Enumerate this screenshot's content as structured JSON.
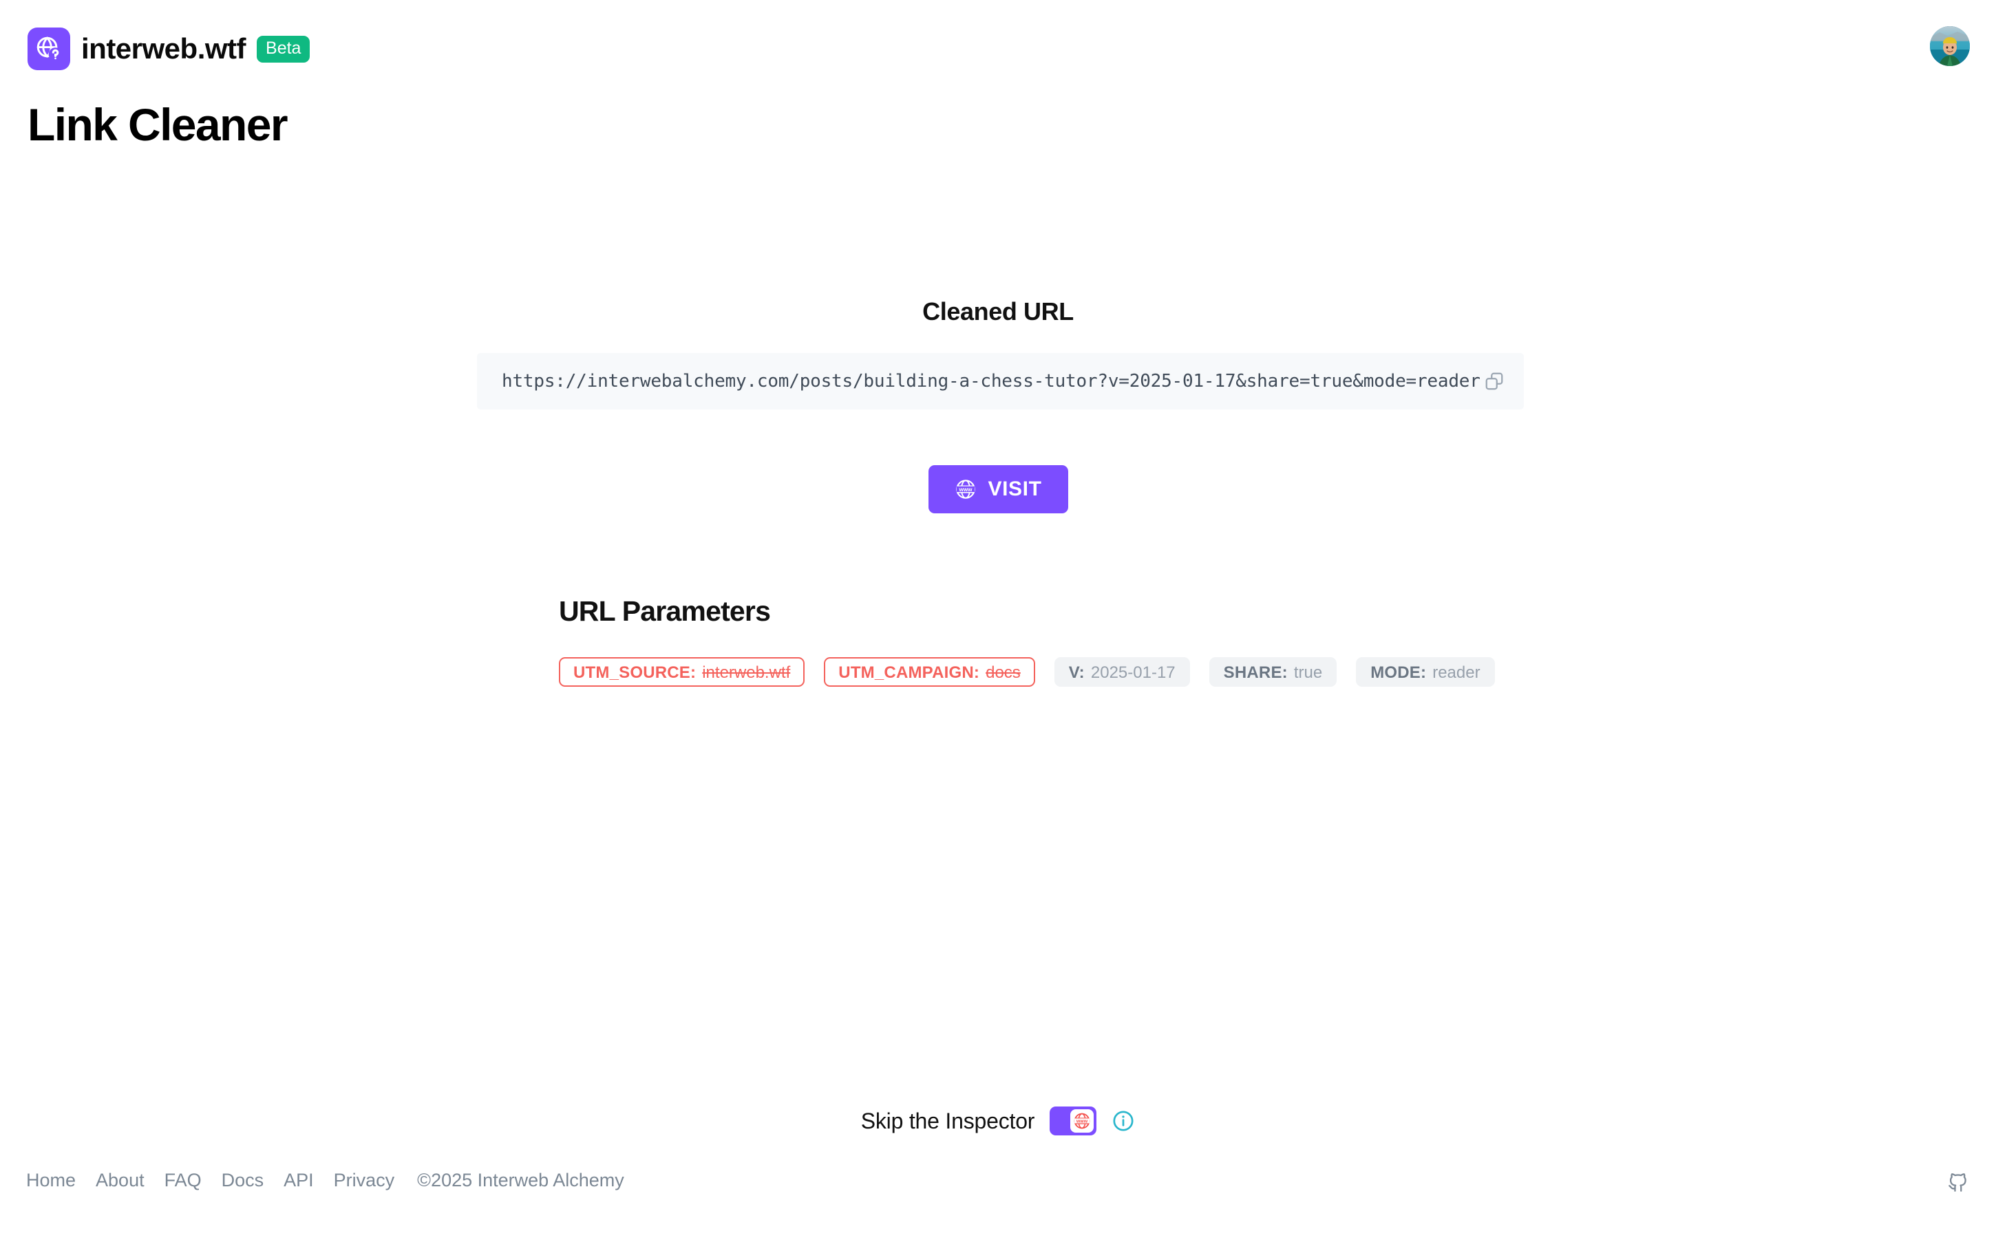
{
  "brand": {
    "name": "interweb.wtf",
    "badge": "Beta",
    "logo_icon": "globe-question-icon"
  },
  "page": {
    "title": "Link Cleaner"
  },
  "account": {
    "avatar_icon": "user-avatar-photo"
  },
  "cleaned_url": {
    "heading": "Cleaned URL",
    "value": "https://interwebalchemy.com/posts/building-a-chess-tutor?v=2025-01-17&share=true&mode=reader",
    "copy_icon": "copy-icon"
  },
  "visit": {
    "label": "VISIT",
    "icon": "www-globe-icon"
  },
  "parameters": {
    "heading": "URL Parameters",
    "items": [
      {
        "key": "UTM_SOURCE:",
        "value": "interweb.wtf",
        "tracking": true
      },
      {
        "key": "UTM_CAMPAIGN:",
        "value": "docs",
        "tracking": true
      },
      {
        "key": "V:",
        "value": "2025-01-17",
        "tracking": false
      },
      {
        "key": "SHARE:",
        "value": "true",
        "tracking": false
      },
      {
        "key": "MODE:",
        "value": "reader",
        "tracking": false
      }
    ]
  },
  "inspector": {
    "label": "Skip the Inspector",
    "toggle_state": "on",
    "toggle_icon": "www-globe-icon",
    "info_icon": "info-circle-icon"
  },
  "footer": {
    "links": [
      "Home",
      "About",
      "FAQ",
      "Docs",
      "API",
      "Privacy"
    ],
    "copyright": "©2025 Interweb Alchemy",
    "github_icon": "github-icon"
  },
  "colors": {
    "accent": "#7c4dff",
    "badge_green": "#0fb981",
    "tracking_red": "#f4625c",
    "info_teal": "#29b6cc",
    "muted": "#7b8794"
  }
}
